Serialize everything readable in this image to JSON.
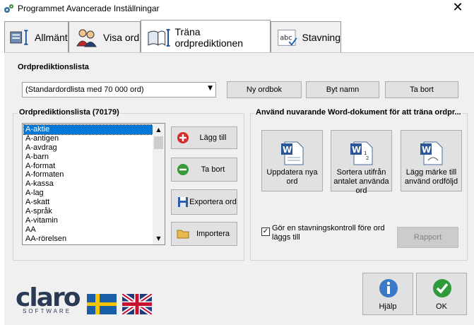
{
  "window": {
    "title": "Programmet Avancerade Inställningar",
    "close_glyph": "✕"
  },
  "tabs": [
    {
      "label": "Allmänt",
      "icon": "settings-icon"
    },
    {
      "label": "Visa ord",
      "icon": "people-icon"
    },
    {
      "label": "Träna ordprediktionen",
      "icon": "book-icon"
    },
    {
      "label": "Stavning",
      "icon": "abc-icon"
    }
  ],
  "prediction_list": {
    "section_label": "Ordprediktionslista",
    "selected": "(Standardordlista med 70 000 ord)",
    "buttons": {
      "new": "Ny ordbok",
      "rename": "Byt namn",
      "delete": "Ta bort"
    }
  },
  "word_list": {
    "group_label": "Ordprediktionslista (70179)",
    "items": [
      "A-aktie",
      "A-antigen",
      "A-avdrag",
      "A-barn",
      "A-format",
      "A-formaten",
      "A-kassa",
      "A-lag",
      "A-skatt",
      "A-språk",
      "A-vitamin",
      "AA",
      "AA-rörelsen"
    ],
    "selected_index": 0,
    "actions": {
      "add": "Lägg till",
      "remove": "Ta bort",
      "export": "Exportera ord",
      "import": "Importera"
    }
  },
  "word_doc": {
    "group_label": "Använd nuvarande Word-dokument för att träna ordpr...",
    "buttons": {
      "update": "Uppdatera nya ord",
      "sort": "Sortera utifrån antalet använda ord",
      "mark": "Lägg märke till använd ordföljd"
    },
    "spellcheck_label": "Gör en stavningskontroll före ord läggs till",
    "spellcheck_checked": true,
    "check_glyph": "✓",
    "report": "Rapport"
  },
  "footer": {
    "logo_text": "claro",
    "logo_sub": "SOFTWARE",
    "help": "Hjälp",
    "ok": "OK"
  },
  "colors": {
    "selection": "#0078d7",
    "ok_green": "#2e9a3a",
    "help_blue": "#3a78c8",
    "add_red": "#d62b2b",
    "remove_green": "#3a9a3a"
  }
}
